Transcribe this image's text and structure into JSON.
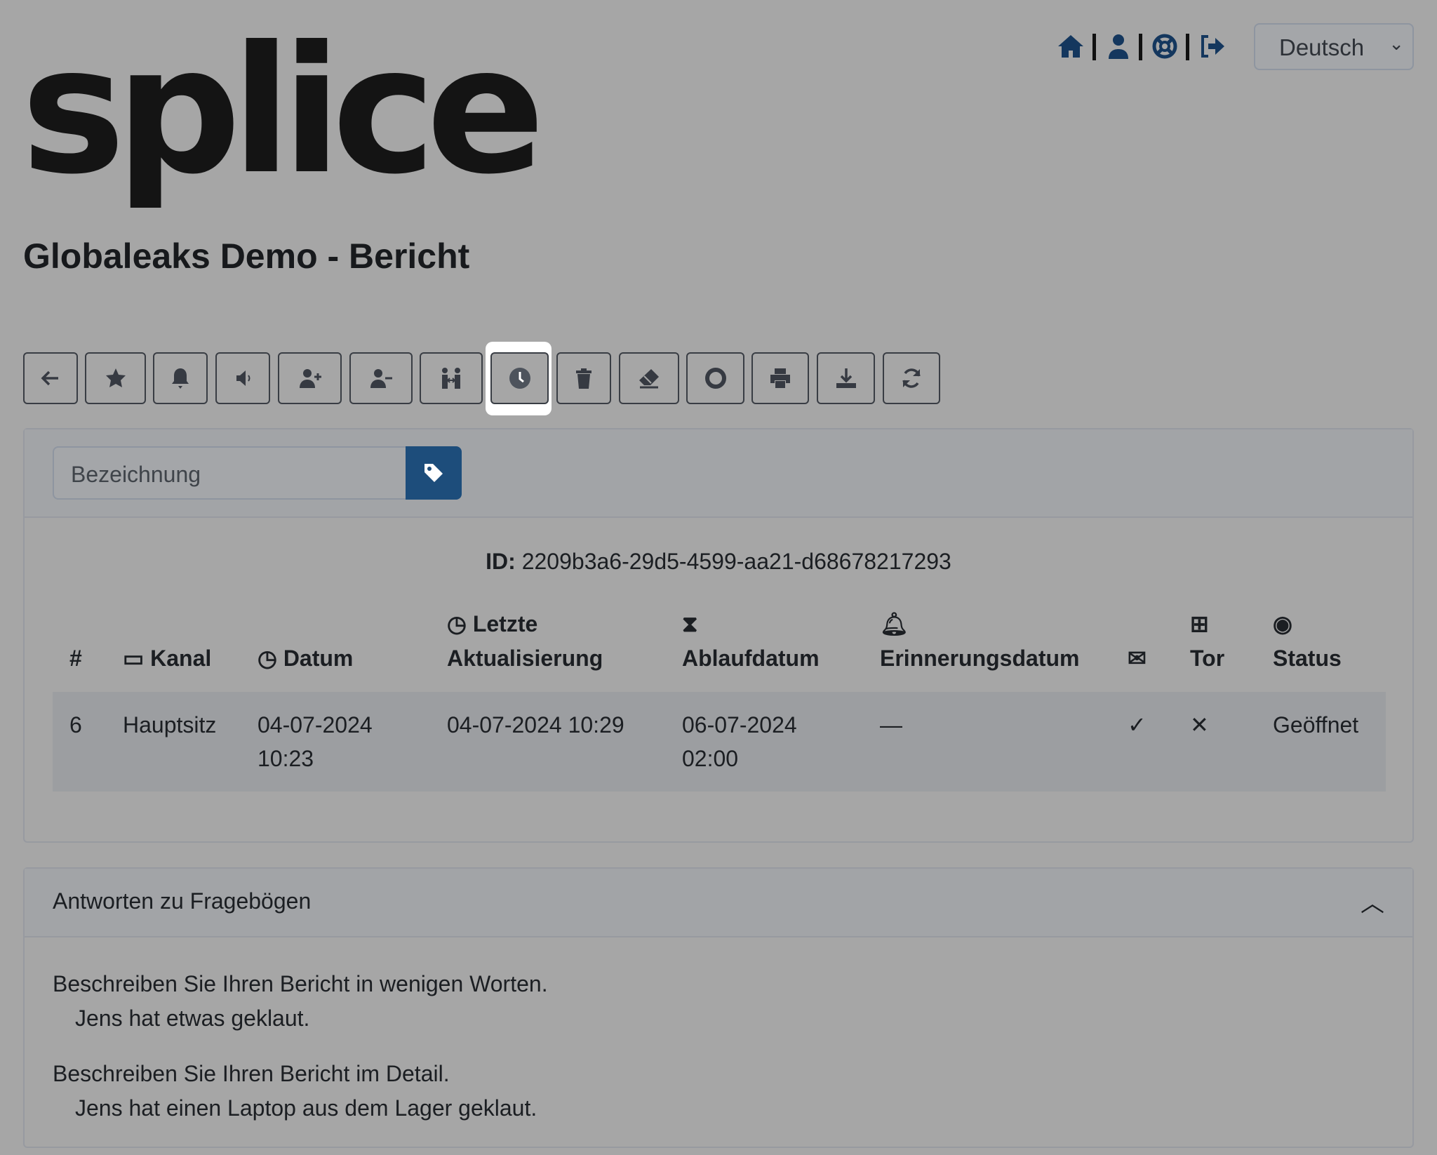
{
  "logo": "splice",
  "header": {
    "icons": [
      "home-icon",
      "user-icon",
      "lifebuoy-icon",
      "sign-out-icon"
    ],
    "language": "Deutsch"
  },
  "title": "Globaleaks Demo - Bericht",
  "toolbar": [
    "arrow-left-icon",
    "star-icon",
    "bell-icon",
    "megaphone-icon",
    "user-plus-icon",
    "user-minus-icon",
    "people-arrows-icon",
    "clock-icon",
    "trash-icon",
    "eraser-icon",
    "circle-dot-icon",
    "print-icon",
    "download-icon",
    "refresh-icon"
  ],
  "label_input": {
    "placeholder": "Bezeichnung"
  },
  "report": {
    "id_label": "ID:",
    "id": "2209b3a6-29d5-4599-aa21-d68678217293"
  },
  "table": {
    "headers": {
      "num": "#",
      "kanal": "Kanal",
      "datum": "Datum",
      "letzte1": "Letzte",
      "letzte2": "Aktualisierung",
      "ablauf": "Ablaufdatum",
      "erinnerung": "Erinnerungsdatum",
      "tor": "Tor",
      "status": "Status"
    },
    "row": {
      "num": "6",
      "kanal": "Hauptsitz",
      "datum1": "04-07-2024",
      "datum2": "10:23",
      "letzte": "04-07-2024 10:29",
      "ablauf1": "06-07-2024",
      "ablauf2": "02:00",
      "erinnerung": "—",
      "mail": "✓",
      "tor": "✕",
      "status": "Geöffnet"
    }
  },
  "answers": {
    "title": "Antworten zu Fragebögen",
    "items": [
      {
        "q": "Beschreiben Sie Ihren Bericht in wenigen Worten.",
        "a": "Jens hat etwas geklaut."
      },
      {
        "q": "Beschreiben Sie Ihren Bericht im Detail.",
        "a": "Jens hat einen Laptop aus dem Lager geklaut."
      }
    ]
  }
}
